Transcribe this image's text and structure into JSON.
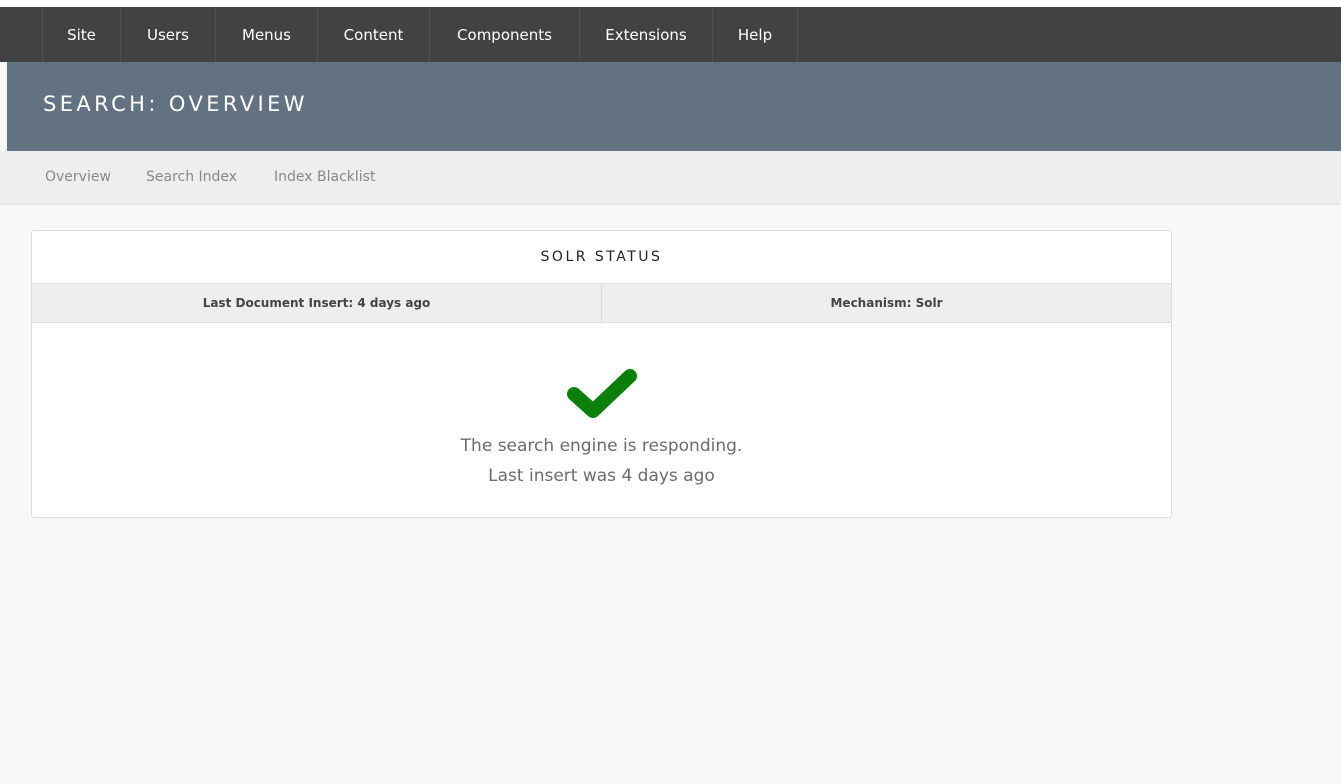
{
  "top_nav": {
    "items": [
      {
        "label": "Site"
      },
      {
        "label": "Users"
      },
      {
        "label": "Menus"
      },
      {
        "label": "Content"
      },
      {
        "label": "Components"
      },
      {
        "label": "Extensions"
      },
      {
        "label": "Help"
      }
    ]
  },
  "header": {
    "title": "SEARCH: OVERVIEW"
  },
  "sub_nav": {
    "items": [
      {
        "label": "Overview"
      },
      {
        "label": "Search Index"
      },
      {
        "label": "Index Blacklist"
      }
    ]
  },
  "solr_panel": {
    "title": "SOLR STATUS",
    "last_insert": "Last Document Insert: 4 days ago",
    "mechanism": "Mechanism: Solr",
    "status_icon": "check-icon",
    "status_color": "#0a7f0a",
    "message_line1": "The search engine is responding.",
    "message_line2": "Last insert was 4 days ago"
  },
  "colors": {
    "top_nav_bg": "#424242",
    "header_bg": "#627280",
    "sub_nav_bg": "#eeeeee",
    "page_bg": "#f8f8f8"
  }
}
